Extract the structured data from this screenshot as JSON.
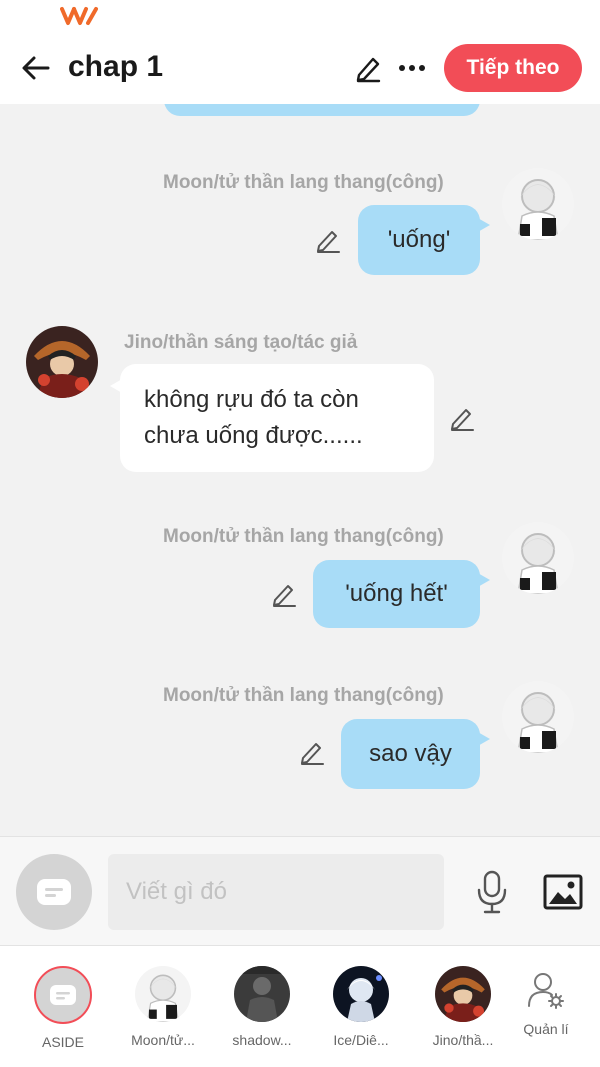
{
  "status_bar": {
    "carrier_logo": "carrier-logo-icon"
  },
  "header": {
    "title": "chap 1",
    "next_label": "Tiếp theo",
    "back_icon": "arrow-left-icon",
    "edit_icon": "pencil-icon",
    "more_icon": "more-dots-icon"
  },
  "messages": [
    {
      "side": "right",
      "sender": "Moon/tử thần lang thang(công)",
      "text": "'uống'"
    },
    {
      "side": "left",
      "sender": "Jino/thần sáng tạo/tác giả",
      "text": "không rựu đó ta còn chưa uống được......"
    },
    {
      "side": "right",
      "sender": "Moon/tử thần lang thang(công)",
      "text": "'uống hết'"
    },
    {
      "side": "right",
      "sender": "Moon/tử thần lang thang(công)",
      "text": "sao vậy"
    }
  ],
  "composer": {
    "placeholder": "Viết gì đó",
    "mic_icon": "microphone-icon",
    "image_icon": "image-icon"
  },
  "characters": [
    {
      "label": "ASIDE",
      "selected": true
    },
    {
      "label": "Moon/tử..."
    },
    {
      "label": "shadow..."
    },
    {
      "label": "Ice/Diê..."
    },
    {
      "label": "Jino/thầ..."
    }
  ],
  "manage": {
    "label": "Quản lí",
    "icon": "user-settings-icon"
  },
  "colors": {
    "accent": "#f24d57",
    "bubble_blue": "#a8dcf7",
    "background": "#f2f2f2",
    "sender_gray": "#a6a6a6"
  }
}
